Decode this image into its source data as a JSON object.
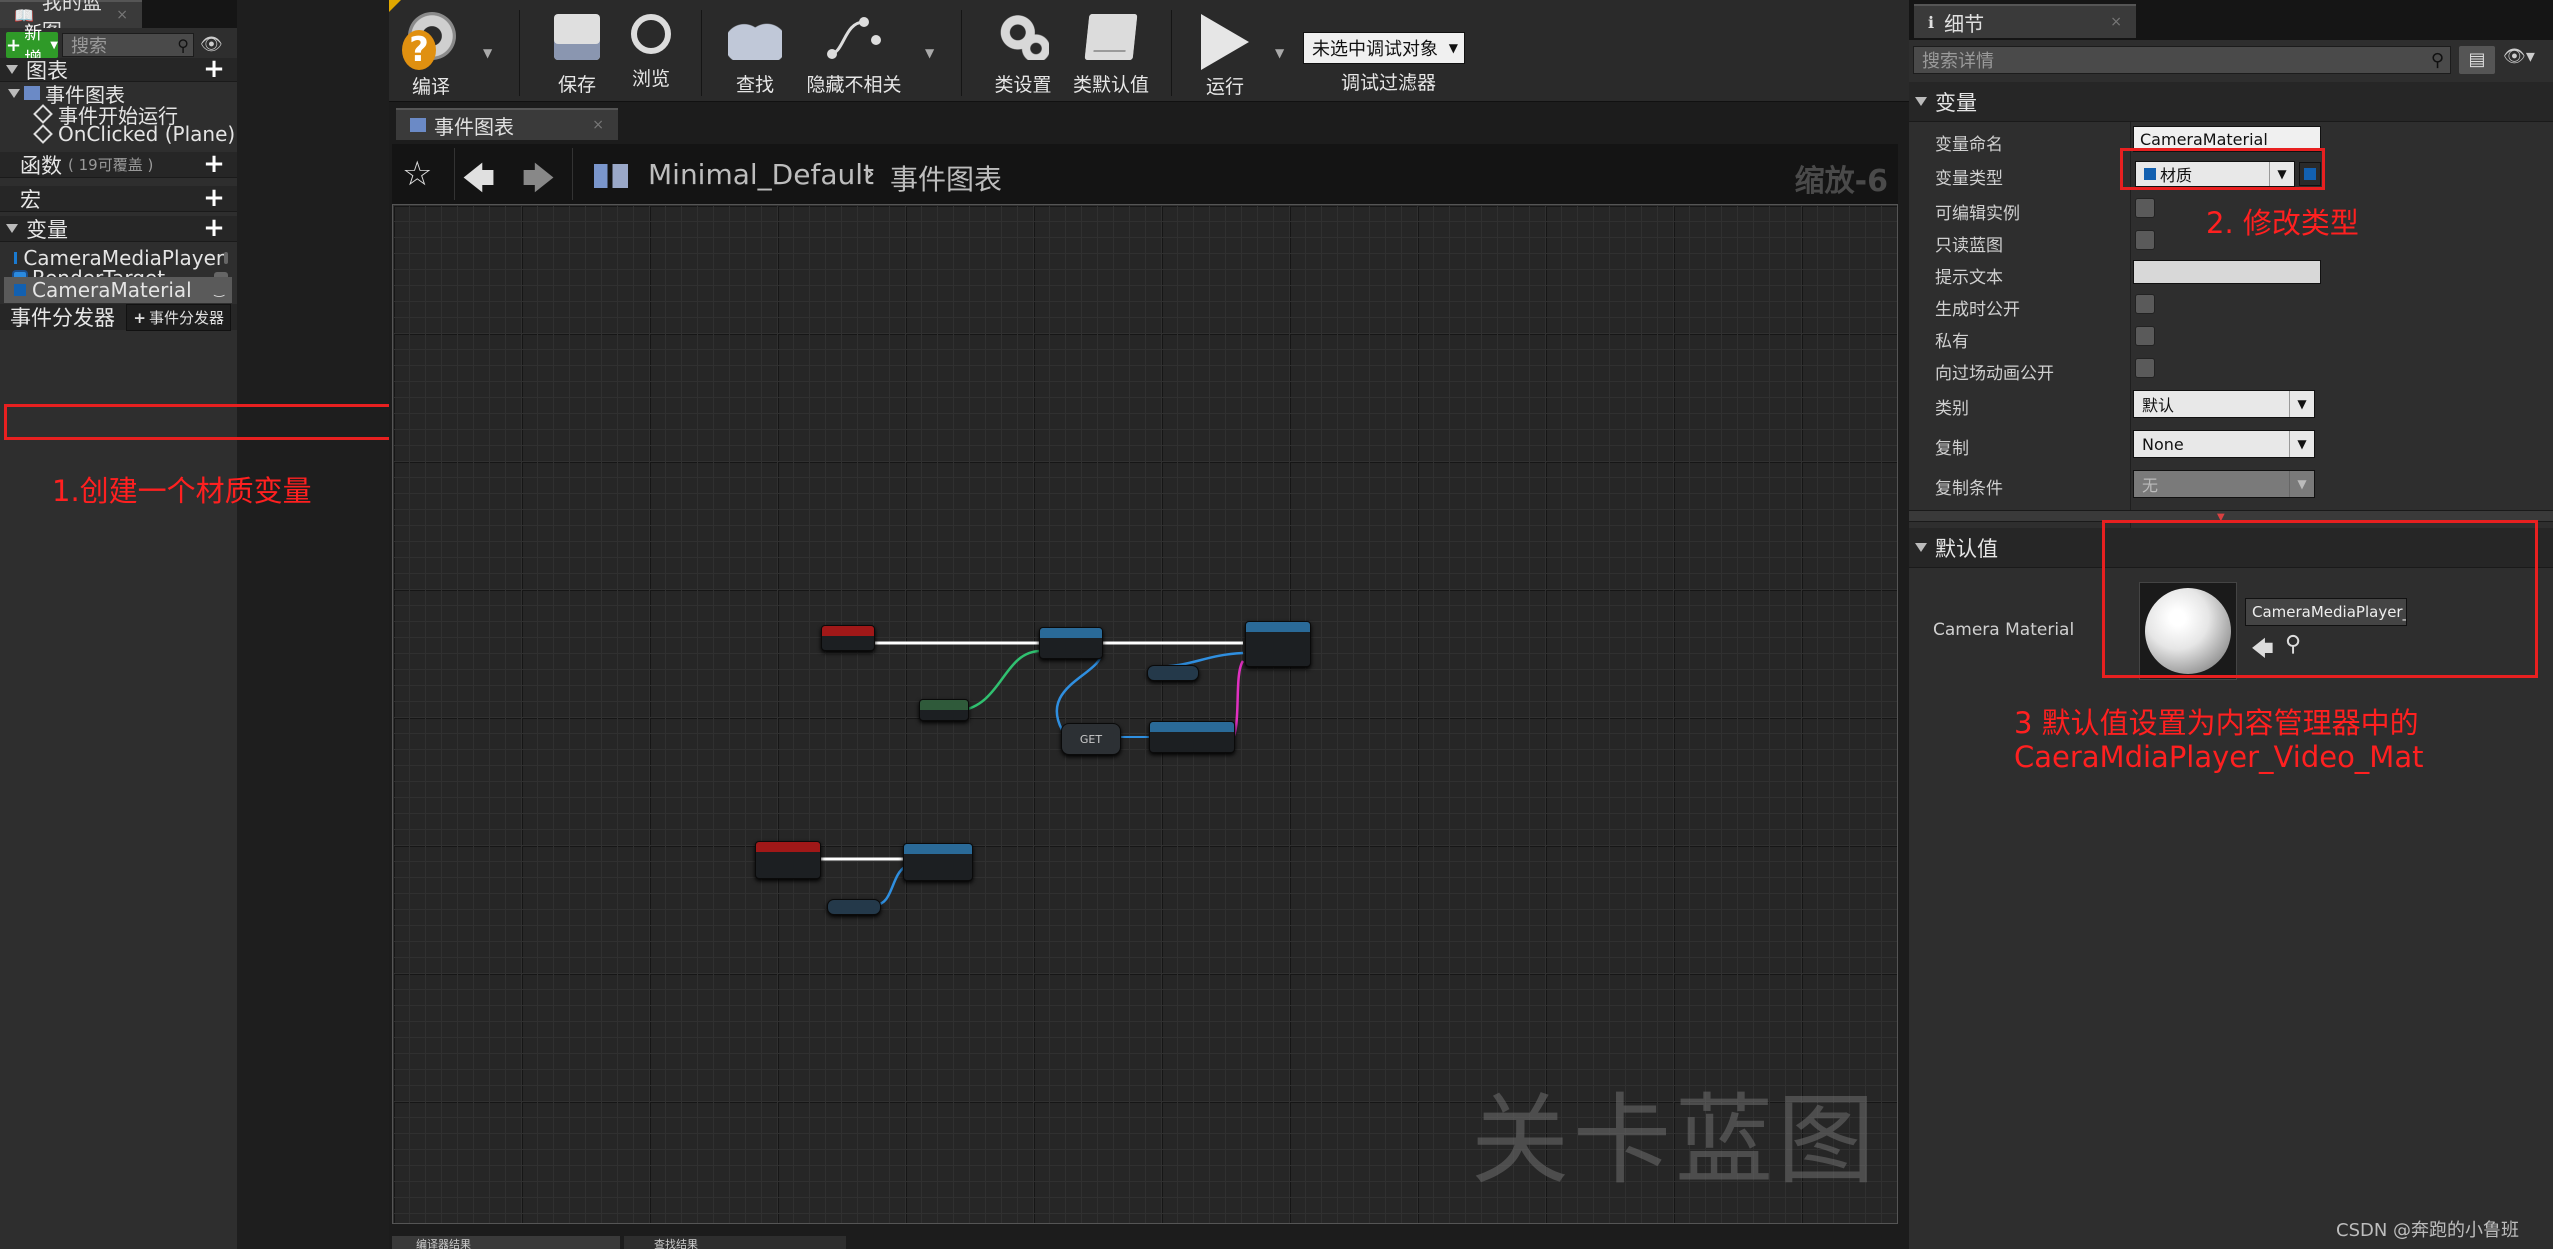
{
  "my_blueprint": {
    "tab_title": "我的蓝图",
    "add_new_label": "新增",
    "search_placeholder": "搜索",
    "graphs_header": "图表",
    "event_graph_label": "事件图表",
    "graph_items": [
      "事件开始运行",
      "OnClicked (Plane)"
    ],
    "functions_header": "函数",
    "functions_override": "( 19可覆盖 )",
    "macros_header": "宏",
    "variables_header": "变量",
    "variables": [
      "CameraMediaPlayer",
      "RenderTarget",
      "CameraMaterial"
    ],
    "dispatchers_header": "事件分发器",
    "dispatcher_button": "事件分发器"
  },
  "toolbar": {
    "compile": "编译",
    "save": "保存",
    "browse": "浏览",
    "find": "查找",
    "hide_unrelated": "隐藏不相关",
    "class_settings": "类设置",
    "class_defaults": "类默认值",
    "play": "运行",
    "debug_object": "未选中调试对象",
    "debug_filter": "调试过滤器"
  },
  "graph": {
    "tab_title": "事件图表",
    "breadcrumb_root": "Minimal_Default",
    "breadcrumb_current": "事件图表",
    "zoom": "缩放-6",
    "watermark": "关卡蓝图",
    "get_node": "GET",
    "bottom_tabs": [
      "编译器结果",
      "查找结果"
    ]
  },
  "details": {
    "tab_title": "细节",
    "search_placeholder": "搜索详情",
    "variable_section": "变量",
    "labels": {
      "name": "变量命名",
      "type": "变量类型",
      "editable": "可编辑实例",
      "readonly": "只读蓝图",
      "tooltip": "提示文本",
      "expose_spawn": "生成时公开",
      "private": "私有",
      "expose_cinematics": "向过场动画公开",
      "category": "类别",
      "replication": "复制",
      "rep_condition": "复制条件"
    },
    "values": {
      "name": "CameraMaterial",
      "type": "材质",
      "category": "默认",
      "replication": "None",
      "rep_condition": "无"
    },
    "default_section": "默认值",
    "default_label": "Camera Material",
    "default_asset": "CameraMediaPlayer_Video_Mat"
  },
  "annotations": {
    "step1": "1.创建一个材质变量",
    "step2": "2. 修改类型",
    "step3_line1": "3 默认值设置为内容管理器中的",
    "step3_line2": "CaeraMdiaPlayer_Video_Mat"
  },
  "credit": "CSDN @奔跑的小鲁班",
  "colors": {
    "annotation_red": "#ff2020",
    "event_node": "#a01818",
    "function_node": "#2a6a98",
    "exec_wire": "#ffffff",
    "object_wire": "#2f8fe0",
    "material_wire": "#e030c0",
    "green_wire": "#30c070"
  }
}
